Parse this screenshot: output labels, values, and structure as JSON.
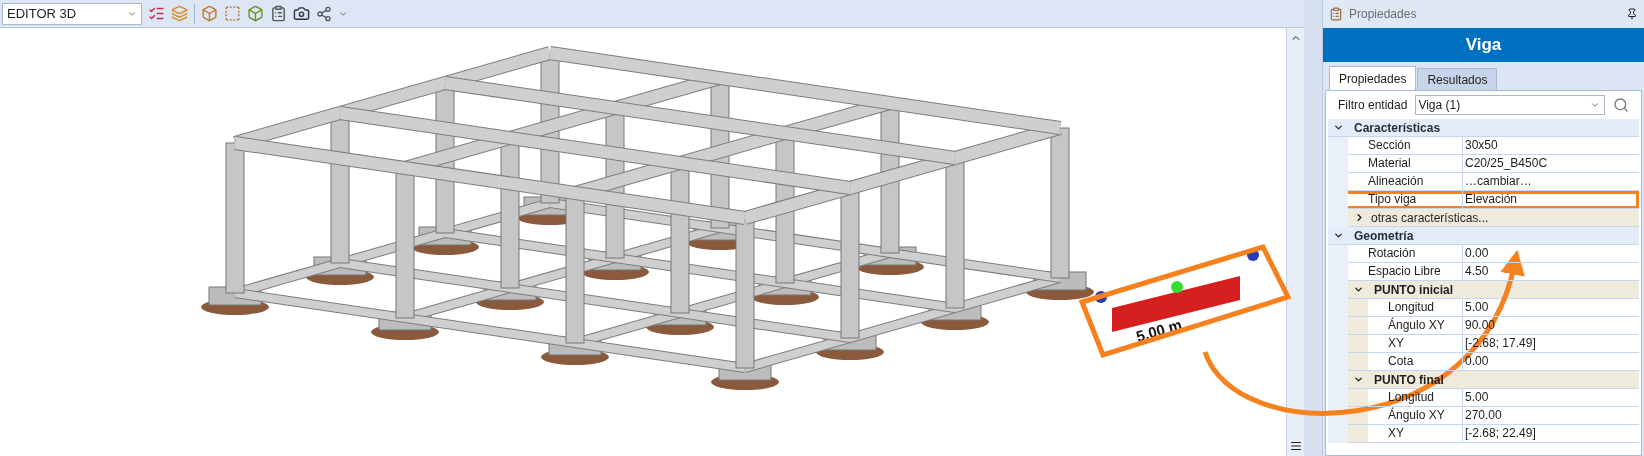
{
  "toolbar": {
    "view_select": "EDITOR 3D"
  },
  "viewport": {
    "dimension_label": "5.00 m"
  },
  "panel": {
    "title": "Propiedades",
    "header": "Viga",
    "tabs": [
      {
        "label": "Propiedades",
        "selected": true
      },
      {
        "label": "Resultados",
        "selected": false
      }
    ],
    "filter": {
      "label": "Filtro entidad",
      "value": "Viga (1)"
    },
    "groups": [
      {
        "title": "Características",
        "expanded": true,
        "rows": [
          {
            "kind": "prop",
            "name": "Sección",
            "value": "30x50",
            "highlighted": false
          },
          {
            "kind": "prop",
            "name": "Material",
            "value": "C20/25_B450C",
            "highlighted": false
          },
          {
            "kind": "prop",
            "name": "Alineación",
            "value": "…cambiar…",
            "highlighted": false
          },
          {
            "kind": "prop",
            "name": "Tipo viga",
            "value": "Elevación",
            "highlighted": true
          },
          {
            "kind": "more",
            "name": "otras características...",
            "expanded": false
          }
        ]
      },
      {
        "title": "Geometría",
        "expanded": true,
        "rows": [
          {
            "kind": "prop",
            "name": "Rotación",
            "value": "0.00",
            "highlighted": false
          },
          {
            "kind": "prop",
            "name": "Espacio Libre",
            "value": "4.50",
            "highlighted": false
          },
          {
            "kind": "subgroup",
            "name": "PUNTO inicial",
            "expanded": true,
            "children": [
              {
                "kind": "prop",
                "name": "Longitud",
                "value": "5.00",
                "highlighted": false
              },
              {
                "kind": "prop",
                "name": "Ángulo XY",
                "value": "90.00",
                "highlighted": false
              },
              {
                "kind": "prop",
                "name": "XY",
                "value": "[-2.68; 17.49]",
                "highlighted": false
              },
              {
                "kind": "prop",
                "name": "Cota",
                "value": "0.00",
                "highlighted": false
              }
            ]
          },
          {
            "kind": "subgroup",
            "name": "PUNTO final",
            "expanded": true,
            "children": [
              {
                "kind": "prop",
                "name": "Longitud",
                "value": "5.00",
                "highlighted": false
              },
              {
                "kind": "prop",
                "name": "Ángulo XY",
                "value": "270.00",
                "highlighted": false
              },
              {
                "kind": "prop",
                "name": "XY",
                "value": "[-2.68; 22.49]",
                "highlighted": false
              }
            ]
          }
        ]
      }
    ]
  }
}
